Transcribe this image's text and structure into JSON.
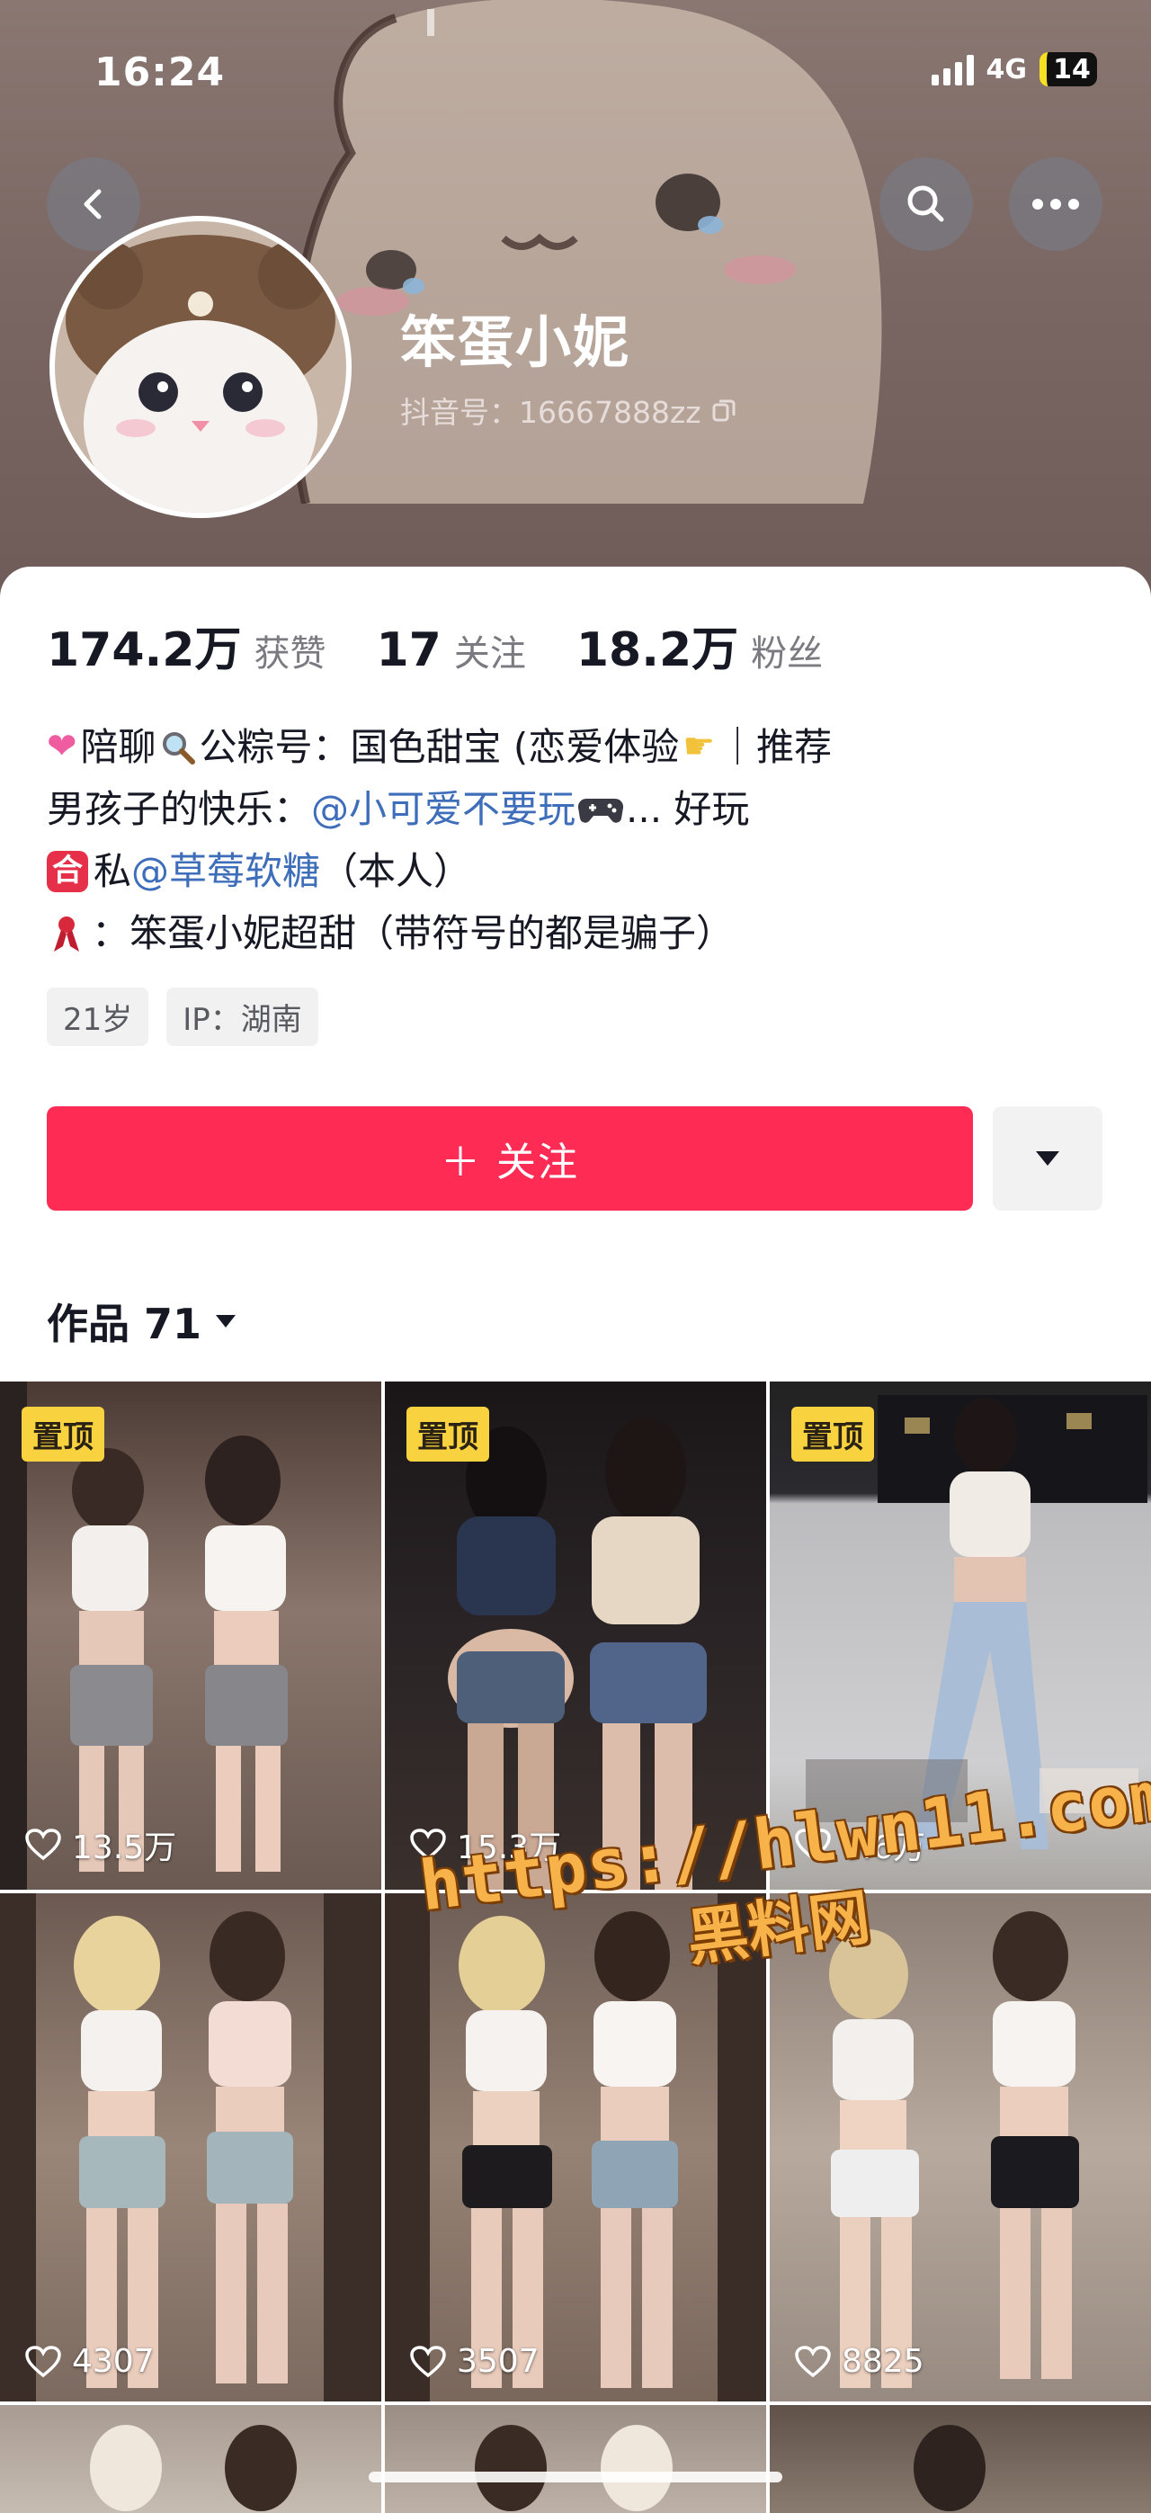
{
  "status_bar": {
    "time": "16:24",
    "network": "4G",
    "battery": "14"
  },
  "header": {
    "back_icon": "chevron-left-icon",
    "search_icon": "search-icon",
    "more_icon": "more-dots-icon"
  },
  "profile": {
    "name": "笨蛋小妮",
    "douyin_id": "抖音号：16667888zz",
    "stats": [
      {
        "value": "174.2万",
        "label": "获赞"
      },
      {
        "value": "17",
        "label": "关注"
      },
      {
        "value": "18.2万",
        "label": "粉丝"
      }
    ],
    "bio": {
      "l1_a": "陪聊",
      "l1_b": "公粽号：国色甜宝 (恋爱体验",
      "l1_c": "｜推荐",
      "l2_a": "男孩子的快乐：",
      "l2_link": "@小可爱不要玩",
      "l2_b": "... 好玩",
      "l3_a": "私",
      "l3_link": "@草莓软糖",
      "l3_b": "（本人）",
      "l4": "：笨蛋小妮超甜（带符号的都是骗子）"
    },
    "tags": [
      "21岁",
      "IP：湖南"
    ],
    "follow_label": "＋ 关注"
  },
  "works": {
    "title": "作品 71",
    "items": [
      {
        "pinned": "置顶",
        "likes": "13.5万"
      },
      {
        "pinned": "置顶",
        "likes": "15.3万"
      },
      {
        "pinned": "置顶",
        "likes": "6.6万"
      },
      {
        "pinned": "",
        "likes": "4307"
      },
      {
        "pinned": "",
        "likes": "3507"
      },
      {
        "pinned": "",
        "likes": "8825"
      }
    ]
  },
  "watermark": {
    "url": "https://hlwn11.com",
    "cn": "黑料网"
  },
  "colors": {
    "accent": "#fe2c55",
    "link": "#3e6dba",
    "pin": "#f9d33f"
  }
}
